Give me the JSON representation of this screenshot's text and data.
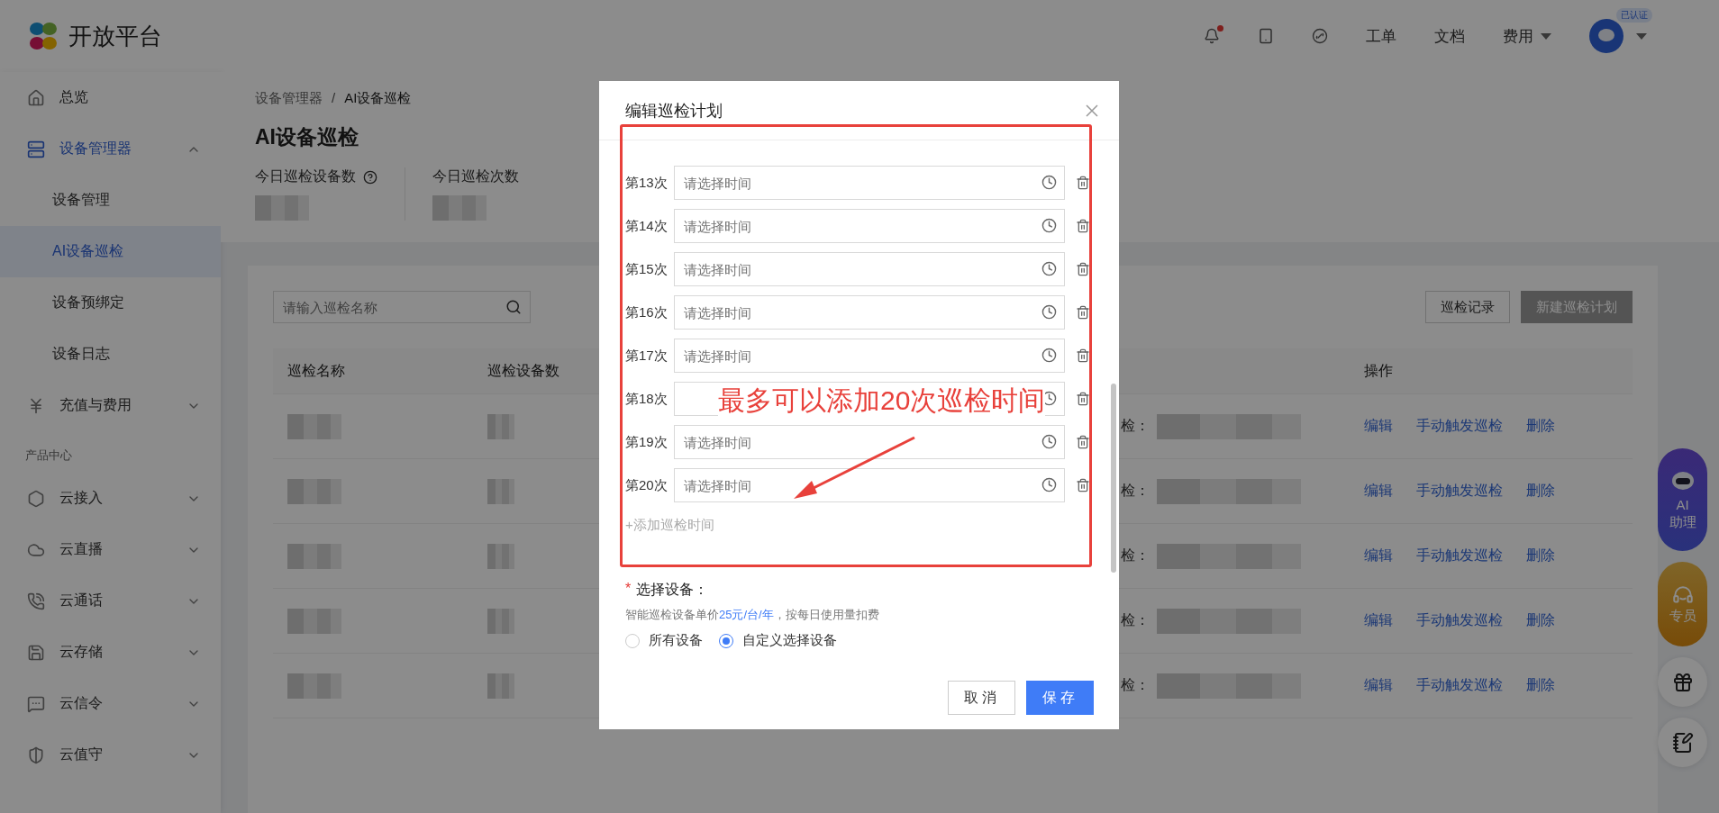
{
  "header": {
    "logo_text": "开放平台",
    "notification_dot": true,
    "nav": [
      {
        "label": "工单",
        "dropdown": false
      },
      {
        "label": "文档",
        "dropdown": false
      },
      {
        "label": "费用",
        "dropdown": true
      }
    ],
    "avatar_badge": "已认证"
  },
  "sidebar": {
    "items": [
      {
        "kind": "menu",
        "label": "总览",
        "selected": false
      },
      {
        "kind": "group",
        "label": "设备管理器",
        "selected": true,
        "expanded": true,
        "children": [
          {
            "label": "设备管理",
            "selected": false
          },
          {
            "label": "AI设备巡检",
            "selected": true
          },
          {
            "label": "设备预绑定",
            "selected": false
          },
          {
            "label": "设备日志",
            "selected": false
          }
        ]
      },
      {
        "kind": "group",
        "label": "充值与费用",
        "selected": false,
        "expanded": false
      },
      {
        "kind": "section",
        "label": "产品中心"
      },
      {
        "kind": "group",
        "label": "云接入",
        "selected": false,
        "expanded": false
      },
      {
        "kind": "group",
        "label": "云直播",
        "selected": false,
        "expanded": false
      },
      {
        "kind": "group",
        "label": "云通话",
        "selected": false,
        "expanded": false
      },
      {
        "kind": "group",
        "label": "云存储",
        "selected": false,
        "expanded": false
      },
      {
        "kind": "group",
        "label": "云信令",
        "selected": false,
        "expanded": false
      },
      {
        "kind": "group",
        "label": "云值守",
        "selected": false,
        "expanded": false
      }
    ]
  },
  "breadcrumb": {
    "items": [
      "设备管理器",
      "AI设备巡检"
    ],
    "separator": "/"
  },
  "title": "AI设备巡检",
  "stats": [
    {
      "label": "今日巡检设备数",
      "help": true
    },
    {
      "label": "今日巡检次数",
      "help": false
    }
  ],
  "toolbar": {
    "search": {
      "placeholder": "请输入巡检名称"
    },
    "buttons": [
      {
        "label": "巡检记录",
        "disabled": false
      },
      {
        "label": "新建巡检计划",
        "disabled": true
      }
    ]
  },
  "table": {
    "columns": [
      "巡检名称",
      "巡检设备数",
      "操作"
    ],
    "rows": [
      {
        "column_3": "检：",
        "actions": [
          "编辑",
          "手动触发巡检",
          "删除"
        ]
      },
      {
        "column_3": "检：",
        "actions": [
          "编辑",
          "手动触发巡检",
          "删除"
        ]
      },
      {
        "column_3": "检：",
        "actions": [
          "编辑",
          "手动触发巡检",
          "删除"
        ]
      },
      {
        "column_3": "检：",
        "actions": [
          "编辑",
          "手动触发巡检",
          "删除"
        ]
      },
      {
        "column_3": "检：",
        "actions": [
          "编辑",
          "手动触发巡检",
          "删除"
        ]
      }
    ]
  },
  "floating": [
    {
      "kind": "ai",
      "lines": [
        "AI",
        "助理"
      ]
    },
    {
      "kind": "agent",
      "lines": [
        "专员"
      ]
    },
    {
      "kind": "gift"
    },
    {
      "kind": "note"
    }
  ],
  "dialog": {
    "title": "编辑巡检计划",
    "times": [
      {
        "label": "第13次",
        "placeholder": "请选择时间"
      },
      {
        "label": "第14次",
        "placeholder": "请选择时间"
      },
      {
        "label": "第15次",
        "placeholder": "请选择时间"
      },
      {
        "label": "第16次",
        "placeholder": "请选择时间"
      },
      {
        "label": "第17次",
        "placeholder": "请选择时间"
      },
      {
        "label": "第18次"
      },
      {
        "label": "第19次",
        "placeholder": "请选择时间"
      },
      {
        "label": "第20次",
        "placeholder": "请选择时间"
      }
    ],
    "add_time": "+添加巡检时间",
    "device": {
      "required_mark": "*",
      "label": "选择设备：",
      "note_before": "智能巡检设备单价",
      "note_price": "25元/台/年",
      "note_after": "，按每日使用量扣费",
      "radios": [
        {
          "label": "所有设备",
          "selected": false
        },
        {
          "label": "自定义选择设备",
          "selected": true
        }
      ]
    },
    "buttons": [
      {
        "label": "取消",
        "kind": "default"
      },
      {
        "label": "保存",
        "kind": "primary"
      }
    ],
    "annotation": "最多可以添加20次巡检时间"
  }
}
